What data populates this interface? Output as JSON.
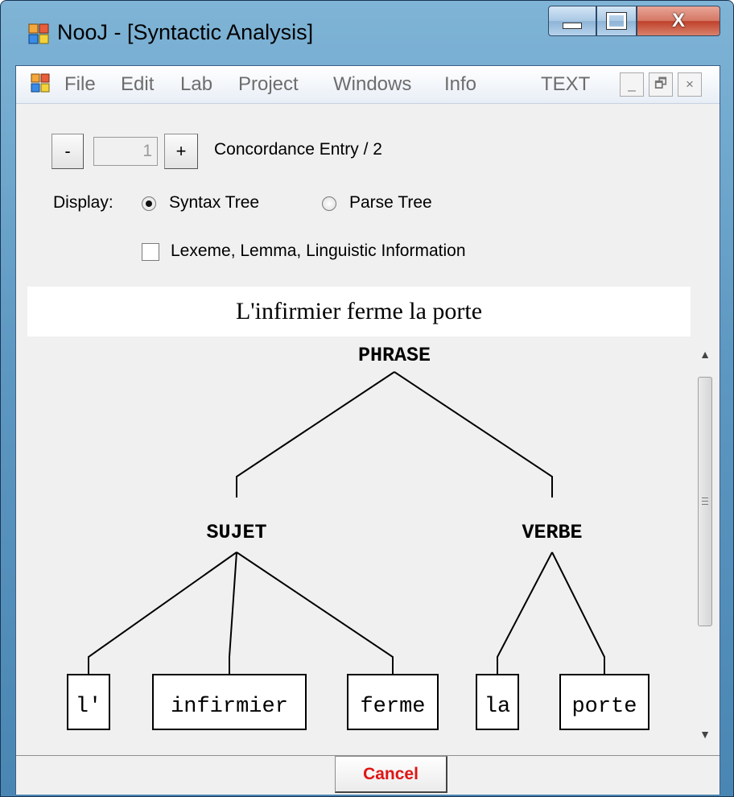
{
  "window": {
    "title": "NooJ - [Syntactic Analysis]",
    "close_glyph": "X"
  },
  "menu": {
    "items": [
      "File",
      "Edit",
      "Lab",
      "Project",
      "Windows",
      "Info",
      "TEXT"
    ],
    "mdi_minimize": "_",
    "mdi_restore": "🗗",
    "mdi_close": "×"
  },
  "entry": {
    "minus_label": "-",
    "plus_label": "+",
    "value": "1",
    "label": "Concordance Entry / 2"
  },
  "display": {
    "label": "Display:",
    "options": [
      "Syntax Tree",
      "Parse Tree"
    ],
    "selected": "Syntax Tree",
    "checkbox_label": "Lexeme, Lemma, Linguistic Information",
    "checkbox_checked": false
  },
  "sentence": "L'infirmier ferme la porte",
  "tree": {
    "root": "PHRASE",
    "nodes": [
      "SUJET",
      "VERBE"
    ],
    "leaves": [
      "l'",
      "infirmier",
      "ferme",
      "la",
      "porte"
    ]
  },
  "buttons": {
    "cancel": "Cancel"
  },
  "colors": {
    "cancel_text": "#e01515",
    "title_bar": "#5d98c2",
    "client_background": "#f0f0f0"
  }
}
